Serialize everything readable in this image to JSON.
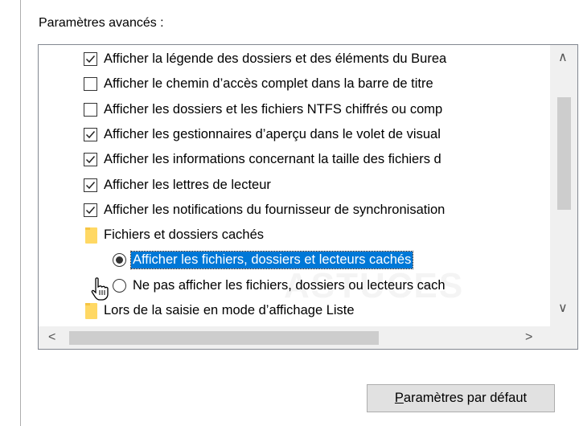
{
  "section_label": "Paramètres avancés :",
  "tree": {
    "items": [
      {
        "type": "checkbox",
        "checked": true,
        "label": "Afficher la légende des dossiers et des éléments du Burea"
      },
      {
        "type": "checkbox",
        "checked": false,
        "label": "Afficher le chemin d’accès complet dans la barre de titre"
      },
      {
        "type": "checkbox",
        "checked": false,
        "label": "Afficher les dossiers et les fichiers NTFS chiffrés ou comp"
      },
      {
        "type": "checkbox",
        "checked": true,
        "label": "Afficher les gestionnaires d’aperçu dans le volet de visual"
      },
      {
        "type": "checkbox",
        "checked": true,
        "label": "Afficher les informations concernant la taille des fichiers d"
      },
      {
        "type": "checkbox",
        "checked": true,
        "label": "Afficher les lettres de lecteur"
      },
      {
        "type": "checkbox",
        "checked": true,
        "label": "Afficher les notifications du fournisseur de synchronisation"
      },
      {
        "type": "folder",
        "label": "Fichiers et dossiers cachés"
      },
      {
        "type": "radio",
        "checked": true,
        "label": "Afficher les fichiers, dossiers et lecteurs cachés"
      },
      {
        "type": "radio",
        "checked": false,
        "label": "Ne pas afficher les fichiers, dossiers ou lecteurs cach"
      },
      {
        "type": "folder",
        "label": "Lors de la saisie en mode d’affichage Liste"
      }
    ]
  },
  "scroll": {
    "up_glyph": "∧",
    "down_glyph": "∨",
    "left_glyph": "<",
    "right_glyph": ">"
  },
  "watermark": "ASTUCES",
  "defaults_button": {
    "accel": "P",
    "rest": "aramètres par défaut"
  },
  "colors": {
    "selection": "#0078d7",
    "folder": "#ffd864",
    "scrollbar_track": "#f0f0f0",
    "scrollbar_thumb": "#cdcdcd"
  },
  "icons": {
    "checkbox": "check-icon",
    "folder": "folder-icon",
    "radio": "radio-icon",
    "cursor": "hand-pointer-icon"
  }
}
